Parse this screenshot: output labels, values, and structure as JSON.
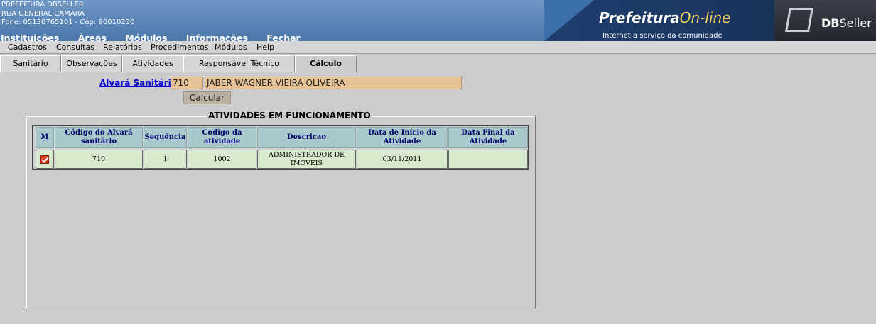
{
  "header": {
    "org_name": "PREFEITURA DBSELLER",
    "address": "RUA GENERAL CAMARA",
    "contact": "Fone: 05130765101  -  Cep: 90010230",
    "nav": [
      "Instituições",
      "Áreas",
      "Módulos",
      "Informações",
      "Fechar"
    ],
    "logo": {
      "title_main": "Prefeitura",
      "title_accent": "On-line",
      "subtitle": "Internet a serviço da comunidade",
      "brand_bold": "DB",
      "brand_rest": "Seller"
    }
  },
  "menu": [
    "Cadastros",
    "Consultas",
    "Relatórios",
    "Procedimentos",
    "Módulos",
    "Help"
  ],
  "tabs": [
    "Sanitário",
    "Observações",
    "Atividades",
    "Responsável Técnico",
    "Cálculo"
  ],
  "active_tab": "Cálculo",
  "form": {
    "label": "Alvará Sanitário:",
    "code_value": "710",
    "name_value": "JABER WAGNER VIEIRA OLIVEIRA",
    "calc_button": "Calcular"
  },
  "fieldset_title": "ATIVIDADES EM FUNCIONAMENTO",
  "grid": {
    "headers": [
      "M",
      "Código do Alvará sanitário",
      "Sequência",
      "Codigo da atividade",
      "Descricao",
      "Data de Início da Atividade",
      "Data Final da Atividade"
    ],
    "rows": [
      {
        "checked": true,
        "codigo": "710",
        "sequencia": "1",
        "codigo_atividade": "1002",
        "descricao": "ADMINISTRADOR DE IMOVEIS",
        "data_inicio": "03/11/2011",
        "data_final": ""
      }
    ]
  },
  "colors": {
    "header_bg": "#4b77ab",
    "input_bg": "#e6c296",
    "grid_header_bg": "#a8c8cc",
    "grid_row_bg": "#d8e8cc",
    "link": "#0000cc"
  }
}
